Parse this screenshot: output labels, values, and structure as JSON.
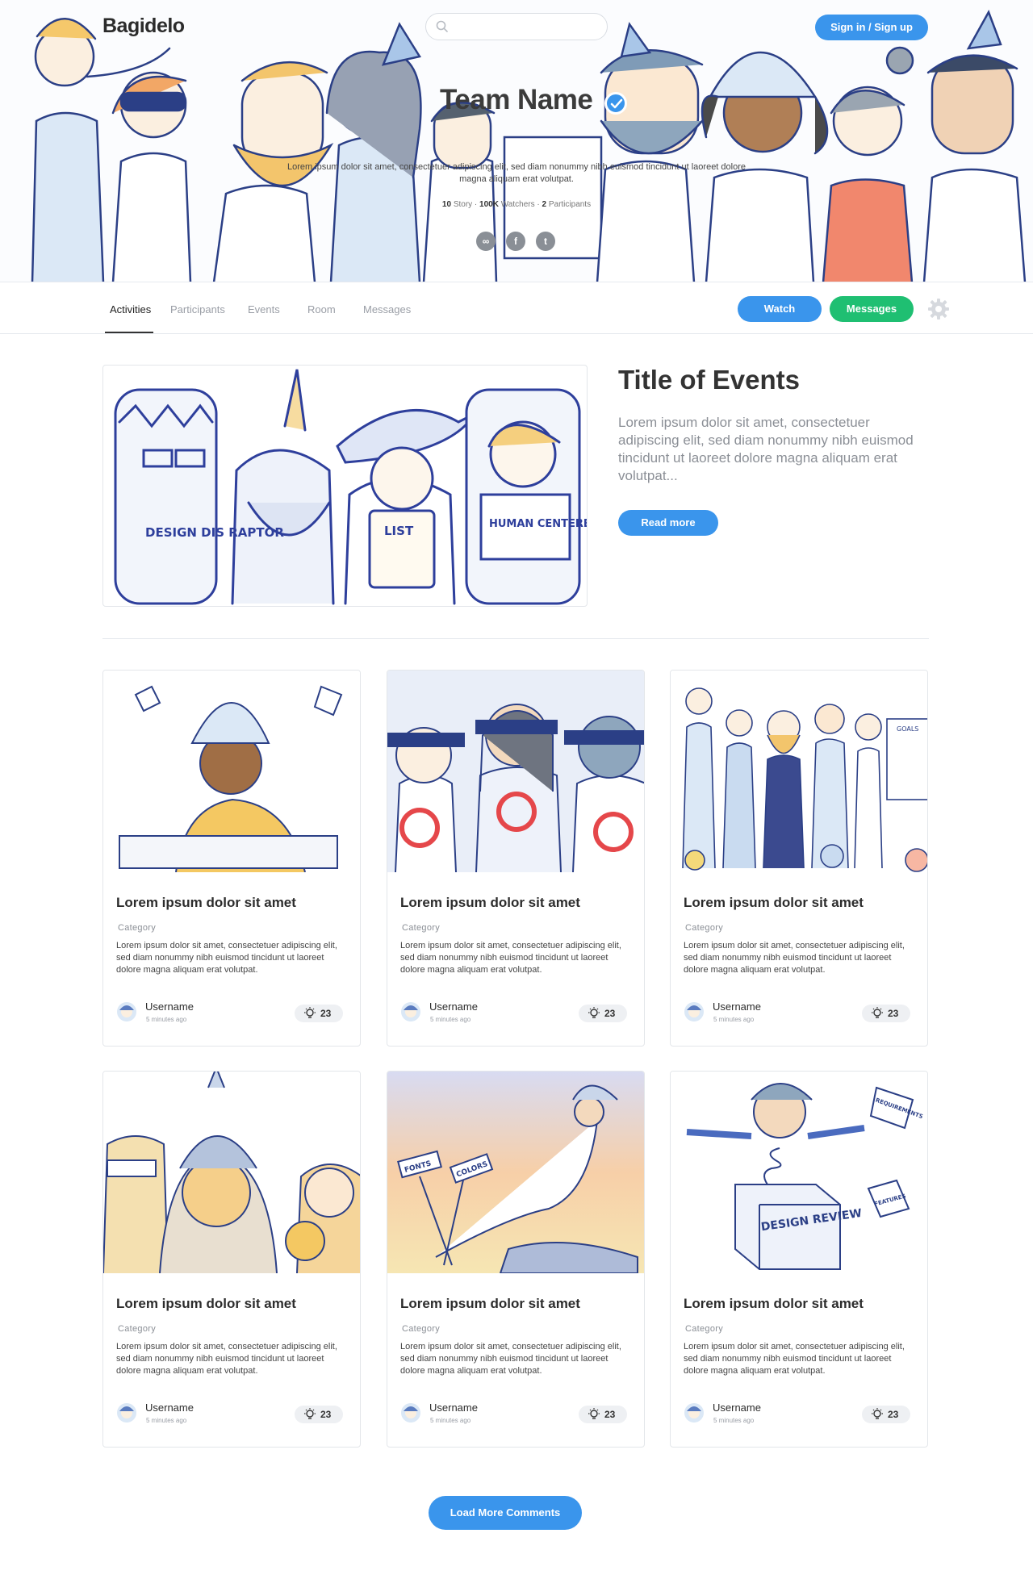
{
  "header": {
    "logo": "Bagidelo",
    "search_placeholder": "",
    "signin_label": "Sign in / Sign up"
  },
  "team": {
    "name": "Team Name",
    "description": "Lorem ipsum dolor sit amet, consectetuer adipiscing elit, sed diam nonummy nibh euismod tincidunt ut laoreet dolore magna aliquam erat volutpat.",
    "stats": {
      "story_count": "10",
      "story_label": "Story",
      "watchers_count": "100K",
      "watchers_label": "Watchers",
      "participants_count": "2",
      "participants_label": "Participants"
    },
    "socials": [
      "link-icon",
      "facebook-icon",
      "twitter-icon"
    ]
  },
  "nav": {
    "tabs": [
      {
        "label": "Activities",
        "active": true
      },
      {
        "label": "Participants",
        "active": false
      },
      {
        "label": "Events",
        "active": false
      },
      {
        "label": "Room",
        "active": false
      },
      {
        "label": "Messages",
        "active": false
      }
    ],
    "watch_label": "Watch",
    "messages_label": "Messages"
  },
  "featured": {
    "title": "Title of Events",
    "description": "Lorem ipsum dolor sit amet, consectetuer adipiscing elit, sed diam nonummy nibh euismod tincidunt ut laoreet dolore magna aliquam erat volutpat...",
    "read_more_label": "Read more",
    "illustration_text": [
      "DESIGN DIS RAPTOR",
      "LIST",
      "HUMAN CENTERED"
    ]
  },
  "cards": [
    {
      "title": "Lorem ipsum dolor sit amet",
      "category": "Category",
      "description": "Lorem ipsum dolor sit amet, consectetuer adipiscing elit, sed diam nonummy nibh euismod tincidunt ut laoreet dolore magna aliquam erat volutpat.",
      "username": "Username",
      "time": "5 minutes ago",
      "likes": "23"
    },
    {
      "title": "Lorem ipsum dolor sit amet",
      "category": "Category",
      "description": "Lorem ipsum dolor sit amet, consectetuer adipiscing elit, sed diam nonummy nibh euismod tincidunt ut laoreet dolore magna aliquam erat volutpat.",
      "username": "Username",
      "time": "5 minutes ago",
      "likes": "23"
    },
    {
      "title": "Lorem ipsum dolor sit amet",
      "category": "Category",
      "description": "Lorem ipsum dolor sit amet, consectetuer adipiscing elit, sed diam nonummy nibh euismod tincidunt ut laoreet dolore magna aliquam erat volutpat.",
      "username": "Username",
      "time": "5 minutes ago",
      "likes": "23"
    },
    {
      "title": "Lorem ipsum dolor sit amet",
      "category": "Category",
      "description": "Lorem ipsum dolor sit amet, consectetuer adipiscing elit, sed diam nonummy nibh euismod tincidunt ut laoreet dolore magna aliquam erat volutpat.",
      "username": "Username",
      "time": "5 minutes ago",
      "likes": "23"
    },
    {
      "title": "Lorem ipsum dolor sit amet",
      "category": "Category",
      "description": "Lorem ipsum dolor sit amet, consectetuer adipiscing elit, sed diam nonummy nibh euismod tincidunt ut laoreet dolore magna aliquam erat volutpat.",
      "username": "Username",
      "time": "5 minutes ago",
      "likes": "23"
    },
    {
      "title": "Lorem ipsum dolor sit amet",
      "category": "Category",
      "description": "Lorem ipsum dolor sit amet, consectetuer adipiscing elit, sed diam nonummy nibh euismod tincidunt ut laoreet dolore magna aliquam erat volutpat.",
      "username": "Username",
      "time": "5 minutes ago",
      "likes": "23"
    }
  ],
  "card_illustration_text": [
    "GOALS",
    "FONTS",
    "COLORS",
    "DESIGN REVIEW",
    "REQUIREMENTS",
    "FEATURES"
  ],
  "load_more_label": "Load More Comments",
  "colors": {
    "primary": "#3a95ec",
    "success": "#1fbf72",
    "ink": "#2b3f86",
    "text": "#333333",
    "muted": "#8b8f96"
  }
}
